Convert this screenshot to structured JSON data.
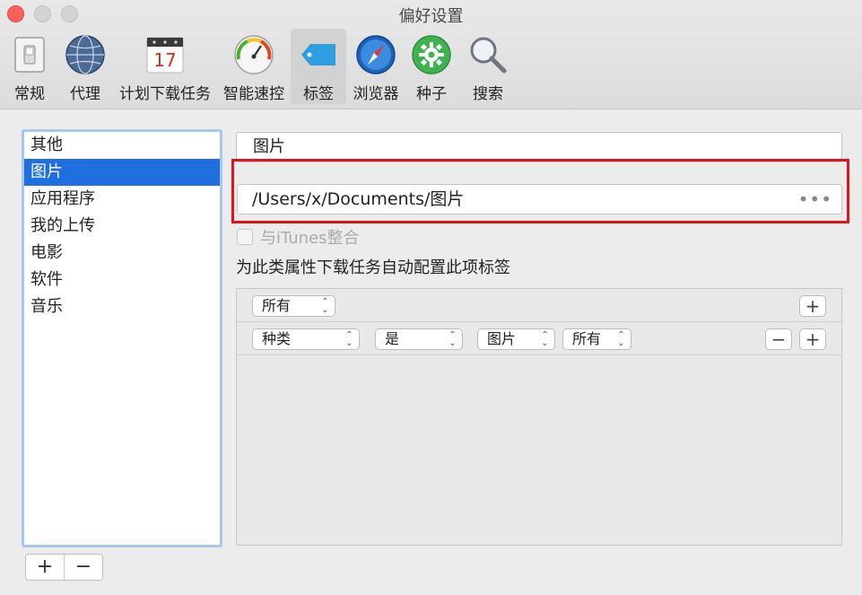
{
  "window": {
    "title": "偏好设置"
  },
  "toolbar": {
    "items": [
      {
        "label": "常规",
        "icon": "general-switch-icon"
      },
      {
        "label": "代理",
        "icon": "globe-icon"
      },
      {
        "label": "计划下载任务",
        "icon": "calendar-icon",
        "calendar_day": "17"
      },
      {
        "label": "智能速控",
        "icon": "speedometer-icon"
      },
      {
        "label": "标签",
        "icon": "tag-icon",
        "active": true
      },
      {
        "label": "浏览器",
        "icon": "compass-icon"
      },
      {
        "label": "种子",
        "icon": "gear-seed-icon"
      },
      {
        "label": "搜索",
        "icon": "magnifier-icon"
      }
    ]
  },
  "categories": {
    "items": [
      "其他",
      "图片",
      "应用程序",
      "我的上传",
      "电影",
      "软件",
      "音乐"
    ],
    "selected": "图片",
    "add_label": "+",
    "remove_label": "−"
  },
  "detail": {
    "name_value": "图片",
    "path_value": "/Users/x/Documents/图片",
    "path_more": "•••",
    "itunes_label": "与iTunes整合",
    "itunes_checked": false,
    "rule_description": "为此类属性下载任务自动配置此项标签",
    "match_selector": "所有",
    "rule": {
      "field": "种类",
      "operator": "是",
      "value": "图片",
      "scope": "所有"
    },
    "add_label": "+",
    "remove_label": "−"
  },
  "colors": {
    "selection": "#1f6fe0",
    "highlight_box": "#e2141b",
    "close_button": "#fc605b"
  }
}
